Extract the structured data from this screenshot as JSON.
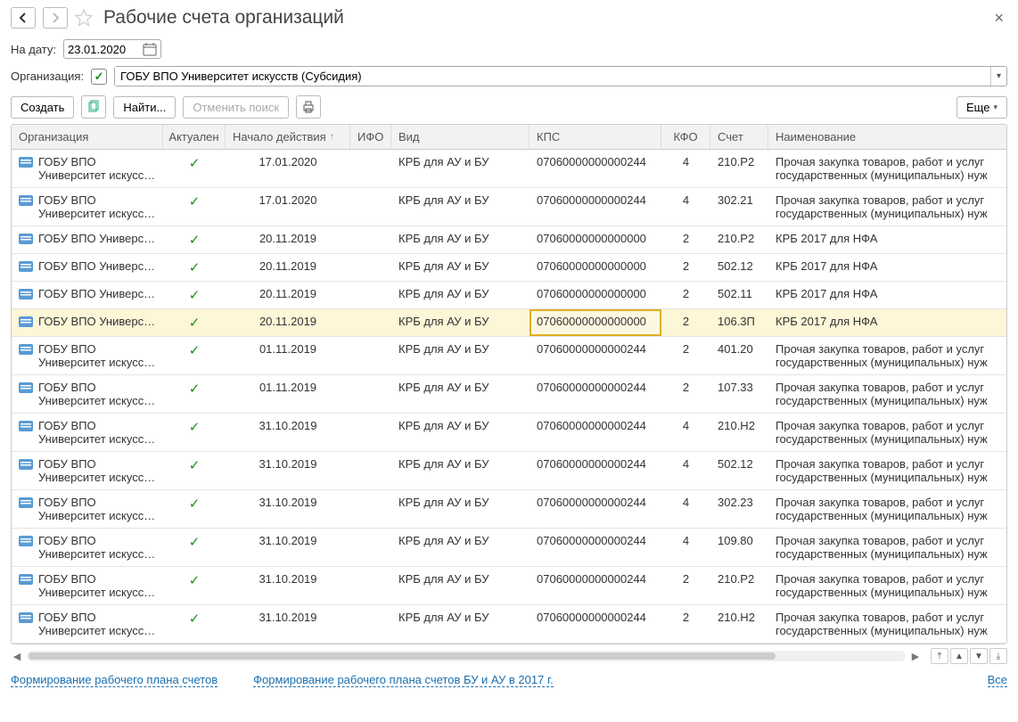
{
  "header": {
    "title": "Рабочие счета организаций"
  },
  "form": {
    "date_label": "На дату:",
    "date_value": "23.01.2020",
    "org_label": "Организация:",
    "org_value": "ГОБУ ВПО Университет искусств (Субсидия)"
  },
  "toolbar": {
    "create": "Создать",
    "find": "Найти...",
    "cancel_search": "Отменить поиск",
    "more": "Еще"
  },
  "columns": {
    "org": "Организация",
    "act": "Актуален",
    "date": "Начало действия",
    "ifo": "ИФО",
    "vid": "Вид",
    "kps": "КПС",
    "kfo": "КФО",
    "schet": "Счет",
    "name": "Наименование"
  },
  "rows": [
    {
      "org_l1": "ГОБУ ВПО",
      "org_l2": "Университет искусст...",
      "date": "17.01.2020",
      "vid": "КРБ для АУ и БУ",
      "kps": "07060000000000244",
      "kfo": "4",
      "schet": "210.Р2",
      "name": "Прочая закупка товаров, работ и услуг государственных (муниципальных) нуж",
      "selected": false,
      "two_line": true
    },
    {
      "org_l1": "ГОБУ ВПО",
      "org_l2": "Университет искусст...",
      "date": "17.01.2020",
      "vid": "КРБ для АУ и БУ",
      "kps": "07060000000000244",
      "kfo": "4",
      "schet": "302.21",
      "name": "Прочая закупка товаров, работ и услуг государственных (муниципальных) нуж",
      "selected": false,
      "two_line": true
    },
    {
      "org_l1": "ГОБУ ВПО Универси...",
      "org_l2": "",
      "date": "20.11.2019",
      "vid": "КРБ для АУ и БУ",
      "kps": "07060000000000000",
      "kfo": "2",
      "schet": "210.Р2",
      "name": "КРБ 2017 для НФА",
      "selected": false,
      "two_line": false
    },
    {
      "org_l1": "ГОБУ ВПО Универси...",
      "org_l2": "",
      "date": "20.11.2019",
      "vid": "КРБ для АУ и БУ",
      "kps": "07060000000000000",
      "kfo": "2",
      "schet": "502.12",
      "name": "КРБ 2017 для НФА",
      "selected": false,
      "two_line": false
    },
    {
      "org_l1": "ГОБУ ВПО Универси...",
      "org_l2": "",
      "date": "20.11.2019",
      "vid": "КРБ для АУ и БУ",
      "kps": "07060000000000000",
      "kfo": "2",
      "schet": "502.11",
      "name": "КРБ 2017 для НФА",
      "selected": false,
      "two_line": false
    },
    {
      "org_l1": "ГОБУ ВПО Универси...",
      "org_l2": "",
      "date": "20.11.2019",
      "vid": "КРБ для АУ и БУ",
      "kps": "07060000000000000",
      "kfo": "2",
      "schet": "106.3П",
      "name": "КРБ 2017 для НФА",
      "selected": true,
      "two_line": false
    },
    {
      "org_l1": "ГОБУ ВПО",
      "org_l2": "Университет искусст...",
      "date": "01.11.2019",
      "vid": "КРБ для АУ и БУ",
      "kps": "07060000000000244",
      "kfo": "2",
      "schet": "401.20",
      "name": "Прочая закупка товаров, работ и услуг государственных (муниципальных) нуж",
      "selected": false,
      "two_line": true
    },
    {
      "org_l1": "ГОБУ ВПО",
      "org_l2": "Университет искусст...",
      "date": "01.11.2019",
      "vid": "КРБ для АУ и БУ",
      "kps": "07060000000000244",
      "kfo": "2",
      "schet": "107.33",
      "name": "Прочая закупка товаров, работ и услуг государственных (муниципальных) нуж",
      "selected": false,
      "two_line": true
    },
    {
      "org_l1": "ГОБУ ВПО",
      "org_l2": "Университет искусст...",
      "date": "31.10.2019",
      "vid": "КРБ для АУ и БУ",
      "kps": "07060000000000244",
      "kfo": "4",
      "schet": "210.Н2",
      "name": "Прочая закупка товаров, работ и услуг государственных (муниципальных) нуж",
      "selected": false,
      "two_line": true
    },
    {
      "org_l1": "ГОБУ ВПО",
      "org_l2": "Университет искусст...",
      "date": "31.10.2019",
      "vid": "КРБ для АУ и БУ",
      "kps": "07060000000000244",
      "kfo": "4",
      "schet": "502.12",
      "name": "Прочая закупка товаров, работ и услуг государственных (муниципальных) нуж",
      "selected": false,
      "two_line": true
    },
    {
      "org_l1": "ГОБУ ВПО",
      "org_l2": "Университет искусст...",
      "date": "31.10.2019",
      "vid": "КРБ для АУ и БУ",
      "kps": "07060000000000244",
      "kfo": "4",
      "schet": "302.23",
      "name": "Прочая закупка товаров, работ и услуг государственных (муниципальных) нуж",
      "selected": false,
      "two_line": true
    },
    {
      "org_l1": "ГОБУ ВПО",
      "org_l2": "Университет искусст...",
      "date": "31.10.2019",
      "vid": "КРБ для АУ и БУ",
      "kps": "07060000000000244",
      "kfo": "4",
      "schet": "109.80",
      "name": "Прочая закупка товаров, работ и услуг государственных (муниципальных) нуж",
      "selected": false,
      "two_line": true
    },
    {
      "org_l1": "ГОБУ ВПО",
      "org_l2": "Университет искусст...",
      "date": "31.10.2019",
      "vid": "КРБ для АУ и БУ",
      "kps": "07060000000000244",
      "kfo": "2",
      "schet": "210.Р2",
      "name": "Прочая закупка товаров, работ и услуг государственных (муниципальных) нуж",
      "selected": false,
      "two_line": true
    },
    {
      "org_l1": "ГОБУ ВПО",
      "org_l2": "Университет искусст...",
      "date": "31.10.2019",
      "vid": "КРБ для АУ и БУ",
      "kps": "07060000000000244",
      "kfo": "2",
      "schet": "210.Н2",
      "name": "Прочая закупка товаров, работ и услуг государственных (муниципальных) нуж",
      "selected": false,
      "two_line": true
    }
  ],
  "footer": {
    "link1": "Формирование рабочего плана счетов",
    "link2": "Формирование рабочего плана счетов БУ и АУ в 2017 г.",
    "all": "Все"
  }
}
